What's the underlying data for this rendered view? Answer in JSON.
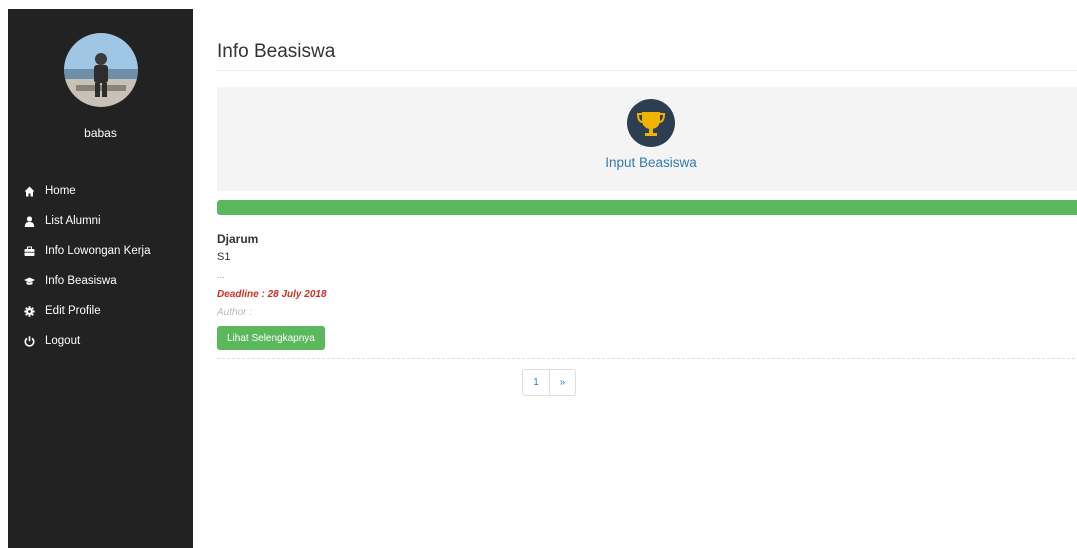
{
  "sidebar": {
    "username": "babas",
    "items": [
      {
        "label": "Home",
        "icon": "home-icon"
      },
      {
        "label": "List Alumni",
        "icon": "user-icon"
      },
      {
        "label": "Info Lowongan Kerja",
        "icon": "briefcase-icon"
      },
      {
        "label": "Info Beasiswa",
        "icon": "graduation-cap-icon"
      },
      {
        "label": "Edit Profile",
        "icon": "gear-icon"
      },
      {
        "label": "Logout",
        "icon": "power-icon"
      }
    ]
  },
  "main": {
    "title": "Info Beasiswa",
    "input_panel": {
      "label": "Input Beasiswa",
      "icon": "trophy-icon"
    },
    "items": [
      {
        "title": "Djarum",
        "level": "S1",
        "excerpt": "...",
        "deadline": "Deadline : 28 July 2018",
        "author": "Author :",
        "button": "Lihat Selengkapnya"
      }
    ],
    "pagination": {
      "current": "1",
      "next": "»"
    }
  },
  "colors": {
    "sidebar_bg": "#222222",
    "accent_green": "#5cb85c",
    "link_blue": "#337ab7",
    "deadline_red": "#c9302c",
    "trophy_circle": "#2c3e50",
    "trophy_gold": "#f0b400"
  }
}
